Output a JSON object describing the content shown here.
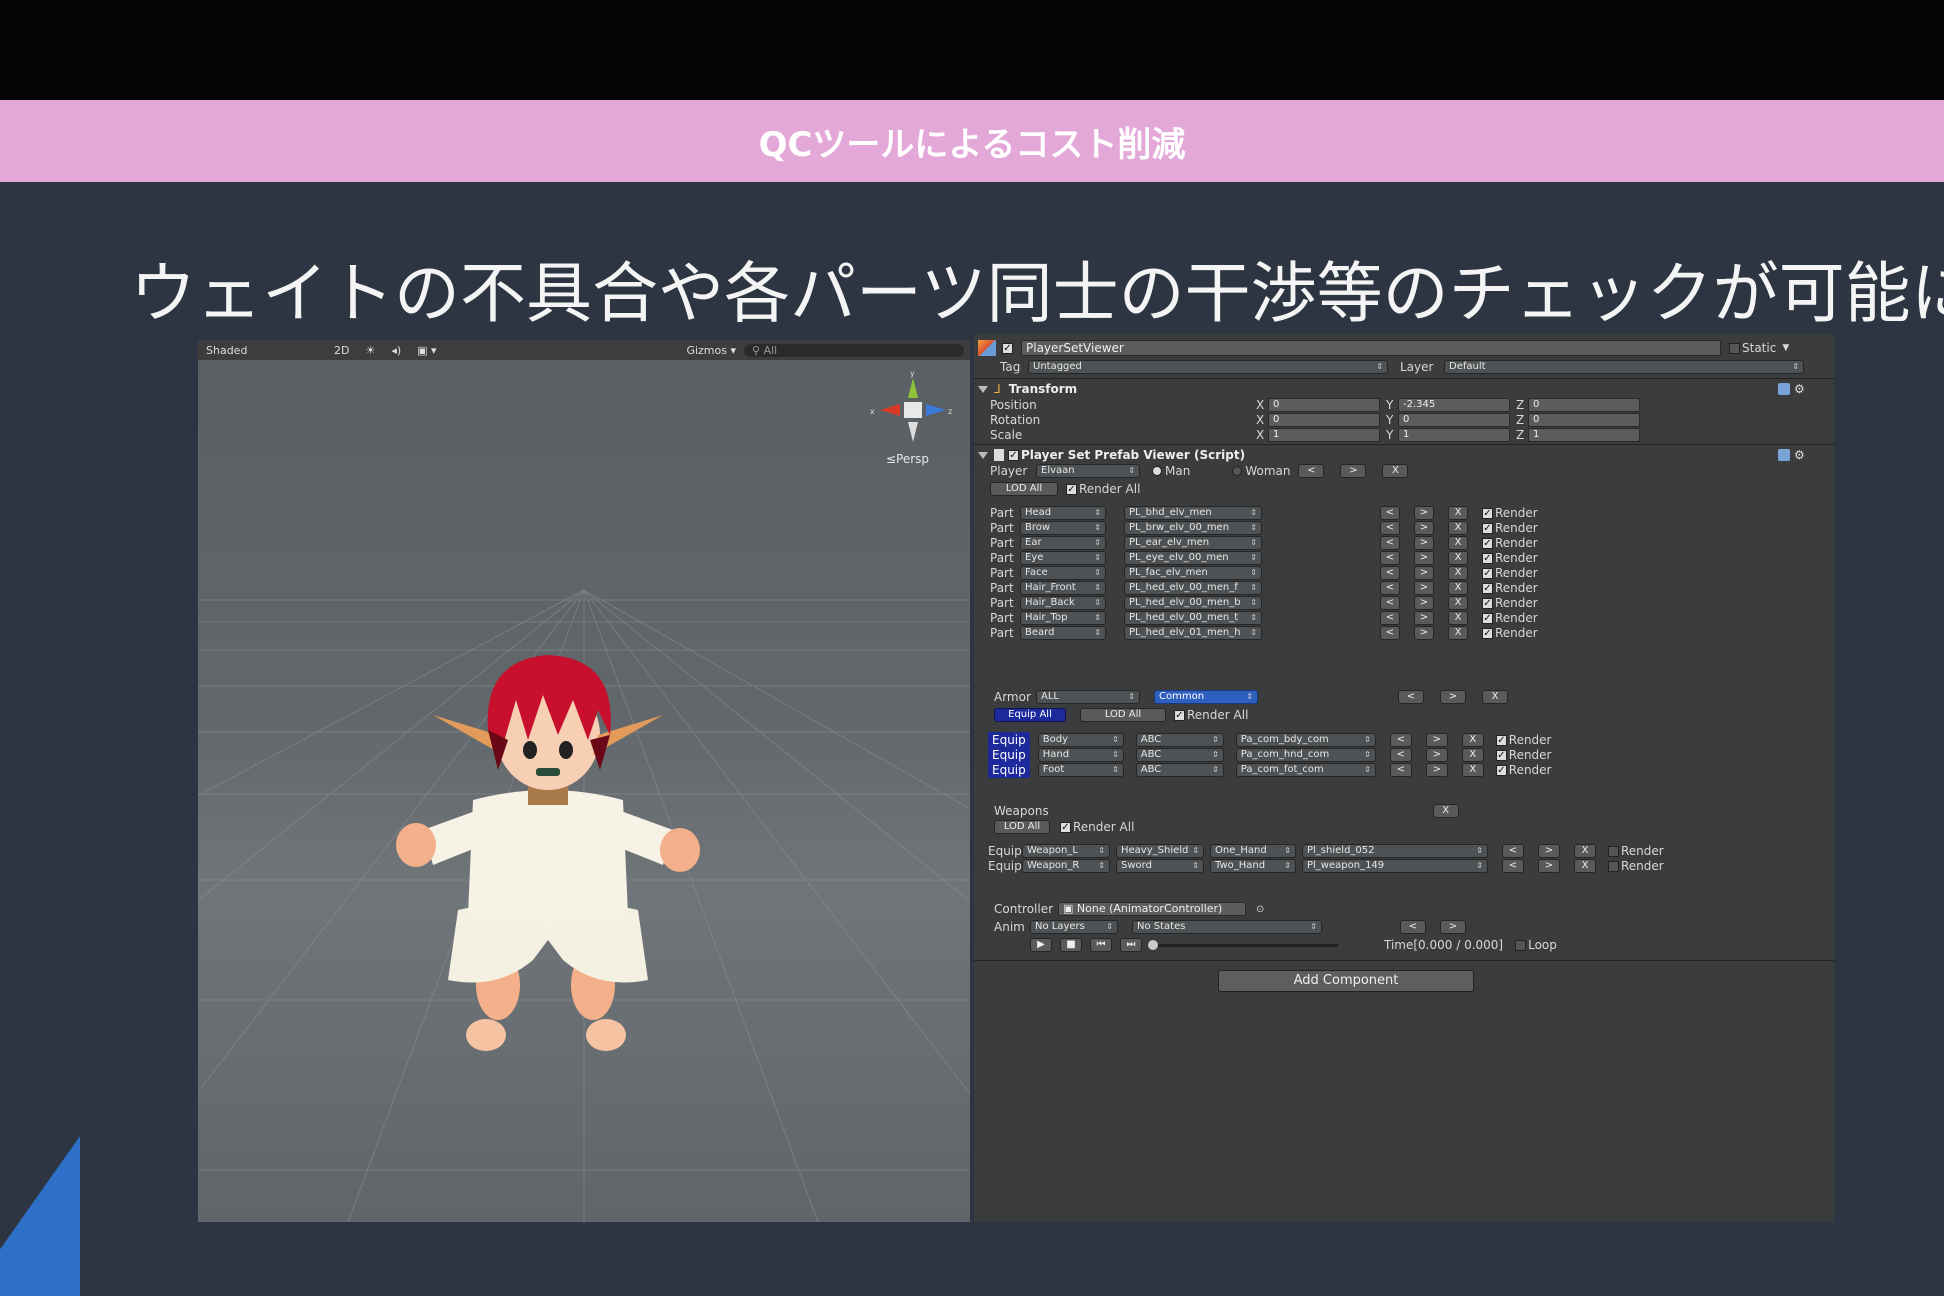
{
  "slide": {
    "banner_title": "QCツールによるコスト削減",
    "headline": "ウェイトの不具合や各パーツ同士の干渉等のチェックが可能に"
  },
  "scene_toolbar": {
    "shaded": "Shaded",
    "mode_2d": "2D",
    "light_icon": "☀",
    "audio_icon": "◂)",
    "gizmos": "Gizmos ▾",
    "search": "All",
    "persp": "≤Persp"
  },
  "inspector": {
    "object_name": "PlayerSetViewer",
    "static_label": "Static",
    "tag_label": "Tag",
    "tag_value": "Untagged",
    "layer_label": "Layer",
    "layer_value": "Default",
    "transform": {
      "title": "Transform",
      "rows": [
        {
          "label": "Position",
          "x": "0",
          "y": "-2.345",
          "z": "0"
        },
        {
          "label": "Rotation",
          "x": "0",
          "y": "0",
          "z": "0"
        },
        {
          "label": "Scale",
          "x": "1",
          "y": "1",
          "z": "1"
        }
      ],
      "x_label": "X",
      "y_label": "Y",
      "z_label": "Z"
    },
    "script": {
      "title": "Player Set Prefab Viewer (Script)",
      "player_label": "Player",
      "player_value": "Elvaan",
      "man_label": "Man",
      "woman_label": "Woman",
      "lod_all": "LOD All",
      "render_all": "Render All",
      "prev": "<",
      "next": ">",
      "close": "X",
      "render": "Render",
      "part_label": "Part",
      "parts": [
        {
          "part": "Head",
          "value": "PL_bhd_elv_men"
        },
        {
          "part": "Brow",
          "value": "PL_brw_elv_00_men"
        },
        {
          "part": "Ear",
          "value": "PL_ear_elv_men"
        },
        {
          "part": "Eye",
          "value": "PL_eye_elv_00_men"
        },
        {
          "part": "Face",
          "value": "PL_fac_elv_men"
        },
        {
          "part": "Hair_Front",
          "value": "PL_hed_elv_00_men_f"
        },
        {
          "part": "Hair_Back",
          "value": "PL_hed_elv_00_men_b"
        },
        {
          "part": "Hair_Top",
          "value": "PL_hed_elv_00_men_t"
        },
        {
          "part": "Beard",
          "value": "PL_hed_elv_01_men_h"
        }
      ],
      "armor_label": "Armor",
      "armor_value": "ALL",
      "armor_set": "Common",
      "equip_all": "Equip All",
      "equip_label": "Equip",
      "armor_rows": [
        {
          "slot": "Body",
          "abc": "ABC",
          "value": "Pa_com_bdy_com"
        },
        {
          "slot": "Hand",
          "abc": "ABC",
          "value": "Pa_com_hnd_com"
        },
        {
          "slot": "Foot",
          "abc": "ABC",
          "value": "Pa_com_fot_com"
        }
      ],
      "weapons_label": "Weapons",
      "weapon_rows": [
        {
          "slot": "Weapon_L",
          "type": "Heavy_Shield",
          "hand": "One_Hand",
          "value": "Pl_shield_052"
        },
        {
          "slot": "Weapon_R",
          "type": "Sword",
          "hand": "Two_Hand",
          "value": "Pl_weapon_149"
        }
      ],
      "controller_label": "Controller",
      "controller_value": "None (AnimatorController)",
      "anim_label": "Anim",
      "layers_value": "No Layers",
      "states_value": "No States",
      "time_label": "Time[0.000 / 0.000]",
      "loop_label": "Loop"
    },
    "add_component": "Add Component"
  },
  "colors": {
    "banner": "#e4a8d8",
    "slide_bg": "#2d3542",
    "inspector_bg": "#3a3c3e",
    "equip_blue": "#1d2a9c",
    "hair_red": "#c8102e"
  }
}
